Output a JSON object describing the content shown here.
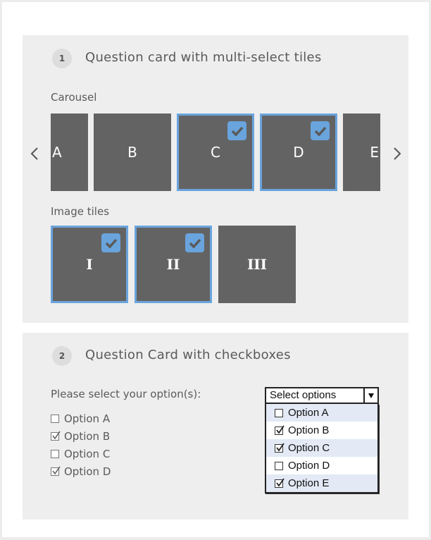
{
  "card1": {
    "number": "1",
    "title": "Question card with multi-select tiles",
    "carousel": {
      "label": "Carousel",
      "tiles": [
        {
          "label": "A",
          "selected": false
        },
        {
          "label": "B",
          "selected": false
        },
        {
          "label": "C",
          "selected": true
        },
        {
          "label": "D",
          "selected": true
        },
        {
          "label": "E",
          "selected": false
        }
      ],
      "prev_icon": "chevron-left-icon",
      "next_icon": "chevron-right-icon"
    },
    "image_tiles": {
      "label": "Image tiles",
      "tiles": [
        {
          "label": "I",
          "selected": true
        },
        {
          "label": "II",
          "selected": true
        },
        {
          "label": "III",
          "selected": false
        }
      ]
    }
  },
  "card2": {
    "number": "2",
    "title": "Question Card with checkboxes",
    "prompt": "Please select your option(s):",
    "checkboxes": [
      {
        "label": "Option A",
        "checked": false
      },
      {
        "label": "Option B",
        "checked": true
      },
      {
        "label": "Option C",
        "checked": false
      },
      {
        "label": "Option D",
        "checked": true
      }
    ],
    "dropdown": {
      "placeholder": "Select options",
      "items": [
        {
          "label": "Option A",
          "checked": false
        },
        {
          "label": "Option B",
          "checked": true
        },
        {
          "label": "Option C",
          "checked": true
        },
        {
          "label": "Option D",
          "checked": false
        },
        {
          "label": "Option E",
          "checked": true
        }
      ]
    }
  },
  "colors": {
    "selected_accent": "#6aa4dd",
    "tile_bg": "#636363",
    "card_bg": "#eeeeee",
    "dropdown_alt_row": "#e3eaf5"
  }
}
